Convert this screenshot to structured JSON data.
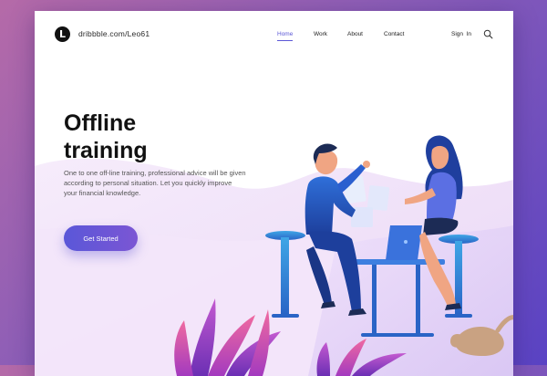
{
  "nav": {
    "logo_mark": "L",
    "logo_text": "dribbble.com/Leo61",
    "links": [
      {
        "label": "Home",
        "active": true
      },
      {
        "label": "Work",
        "active": false
      },
      {
        "label": "About",
        "active": false
      },
      {
        "label": "Contact",
        "active": false
      }
    ],
    "signin_label": "Sign  In",
    "search_icon": "search-icon"
  },
  "hero": {
    "title": "Offline\ntraining",
    "description": "One to one off-line training, professional advice will be given according to personal situation. Let you quickly improve your financial knowledge.",
    "cta_label": "Get Started"
  },
  "colors": {
    "accent": "#5b57d6",
    "page_background": "#8a5db8",
    "card_background": "#ffffff"
  }
}
